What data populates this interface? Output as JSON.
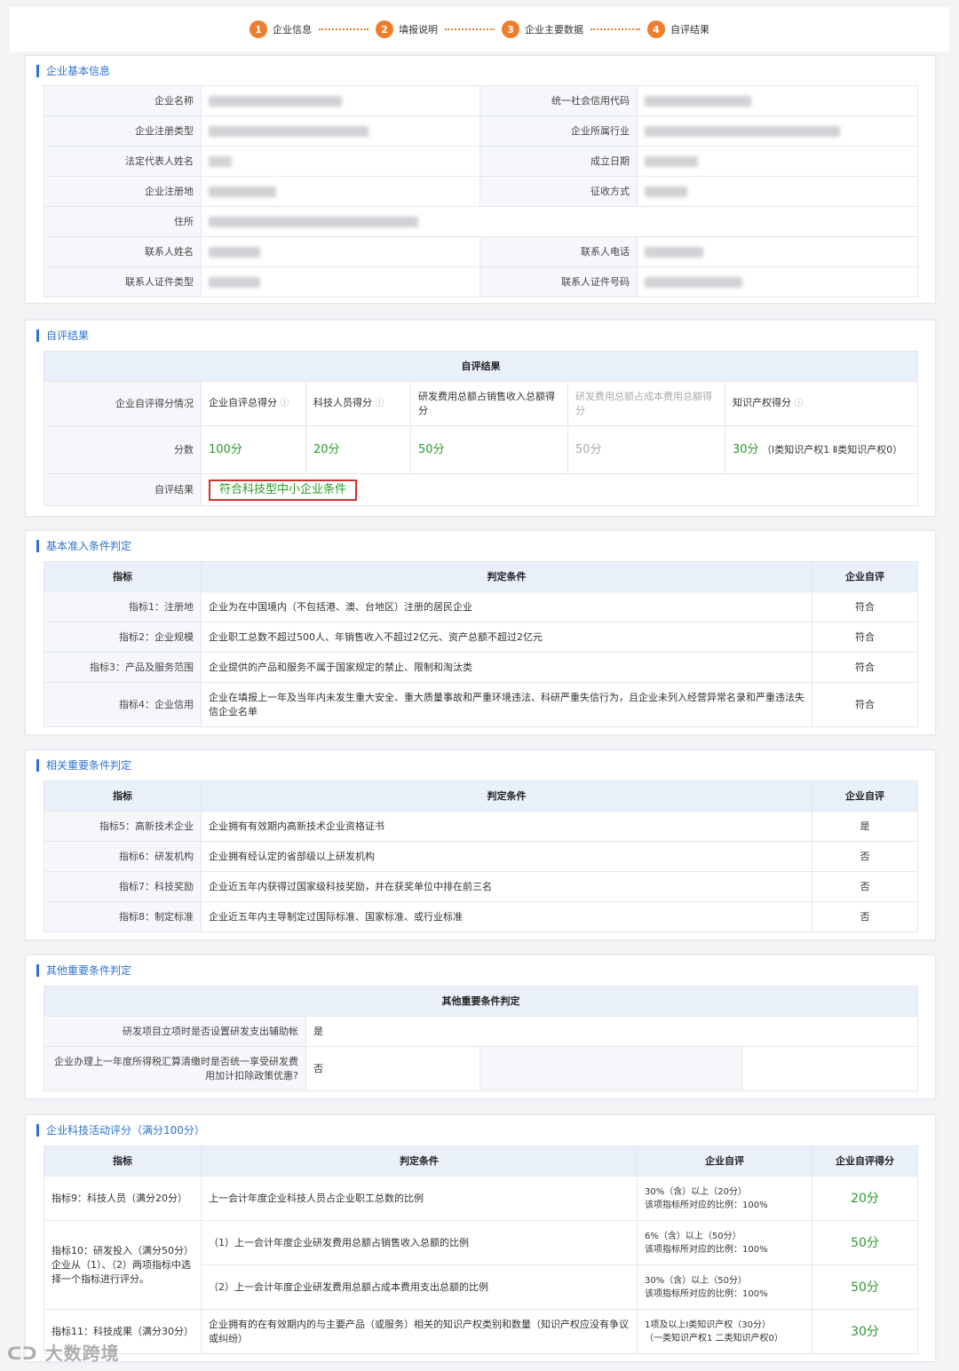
{
  "steps": [
    {
      "num": "1",
      "label": "企业信息"
    },
    {
      "num": "2",
      "label": "填报说明"
    },
    {
      "num": "3",
      "label": "企业主要数据"
    },
    {
      "num": "4",
      "label": "自评结果"
    }
  ],
  "basic": {
    "title": "企业基本信息",
    "rows": [
      {
        "l1": "企业名称",
        "l2": "统一社会信用代码"
      },
      {
        "l1": "企业注册类型",
        "l2": "企业所属行业"
      },
      {
        "l1": "法定代表人姓名",
        "l2": "成立日期"
      },
      {
        "l1": "企业注册地",
        "l2": "征收方式"
      },
      {
        "l1": "住所"
      },
      {
        "l1": "联系人姓名",
        "l2": "联系人电话"
      },
      {
        "l1": "联系人证件类型",
        "l2": "联系人证件号码"
      }
    ]
  },
  "selfeval": {
    "title": "自评结果",
    "header": "自评结果",
    "row_label": "企业自评得分情况",
    "cols": [
      "企业自评总得分",
      "科技人员得分",
      "研发费用总额占销售收入总额得分",
      "研发费用总额占成本费用总额得分",
      "知识产权得分"
    ],
    "score_label": "分数",
    "scores": [
      "100分",
      "20分",
      "50分",
      "50分",
      "30分"
    ],
    "ip_detail": "（Ⅰ类知识产权1 Ⅱ类知识产权0）",
    "result_label": "自评结果",
    "result": "符合科技型中小企业条件"
  },
  "access": {
    "title": "基本准入条件判定",
    "headers": [
      "指标",
      "判定条件",
      "企业自评"
    ],
    "rows": [
      {
        "name": "指标1：注册地",
        "cond": "企业为在中国境内（不包括港、澳、台地区）注册的居民企业",
        "eval": "符合"
      },
      {
        "name": "指标2：企业规模",
        "cond": "企业职工总数不超过500人、年销售收入不超过2亿元、资产总额不超过2亿元",
        "eval": "符合"
      },
      {
        "name": "指标3：产品及服务范围",
        "cond": "企业提供的产品和服务不属于国家规定的禁止、限制和淘汰类",
        "eval": "符合"
      },
      {
        "name": "指标4：企业信用",
        "cond": "企业在填报上一年及当年内未发生重大安全、重大质量事故和严重环境违法、科研严重失信行为，且企业未列入经营异常名录和严重违法失信企业名单",
        "eval": "符合"
      }
    ]
  },
  "important": {
    "title": "相关重要条件判定",
    "headers": [
      "指标",
      "判定条件",
      "企业自评"
    ],
    "rows": [
      {
        "name": "指标5：高新技术企业",
        "cond": "企业拥有有效期内高新技术企业资格证书",
        "eval": "是"
      },
      {
        "name": "指标6：研发机构",
        "cond": "企业拥有经认定的省部级以上研发机构",
        "eval": "否"
      },
      {
        "name": "指标7：科技奖励",
        "cond": "企业近五年内获得过国家级科技奖励，并在获奖单位中排在前三名",
        "eval": "否"
      },
      {
        "name": "指标8：制定标准",
        "cond": "企业近五年内主导制定过国际标准、国家标准、或行业标准",
        "eval": "否"
      }
    ]
  },
  "other": {
    "title": "其他重要条件判定",
    "header": "其他重要条件判定",
    "rows": [
      {
        "q": "研发项目立项时是否设置研发支出辅助帐",
        "a": "是"
      },
      {
        "q": "企业办理上一年度所得税汇算清缴时是否统一享受研发费用加计扣除政策优惠?",
        "a": "否"
      }
    ]
  },
  "activity": {
    "title": "企业科技活动评分（满分100分）",
    "headers": [
      "指标",
      "判定条件",
      "企业自评",
      "企业自评得分"
    ],
    "r9": {
      "name": "指标9：科技人员（满分20分）",
      "cond": "上一会计年度企业科技人员占企业职工总数的比例",
      "eval1": "30%（含）以上（20分）",
      "eval2": "该项指标所对应的比例：100%",
      "score": "20分"
    },
    "r10_name": "指标10：研发投入（满分50分）\n企业从（1）、（2）两项指标中选择一个指标进行评分。",
    "r10a": {
      "cond": "（1）上一会计年度企业研发费用总额占销售收入总额的比例",
      "eval1": "6%（含）以上（50分）",
      "eval2": "该项指标所对应的比例：100%",
      "score": "50分"
    },
    "r10b": {
      "cond": "（2）上一会计年度企业研发费用总额占成本费用支出总额的比例",
      "eval1": "30%（含）以上（50分）",
      "eval2": "该项指标所对应的比例：100%",
      "score": "50分"
    },
    "r11": {
      "name": "指标11：科技成果（满分30分）",
      "cond": "企业拥有的在有效期内的与主要产品（或服务）相关的知识产权类别和数量（知识产权应没有争议或纠纷）",
      "eval1": "1项及以上Ⅰ类知识产权（30分）",
      "eval2": "（一类知识产权1 二类知识产权0）",
      "score": "30分"
    }
  },
  "watermark": "大数跨境"
}
